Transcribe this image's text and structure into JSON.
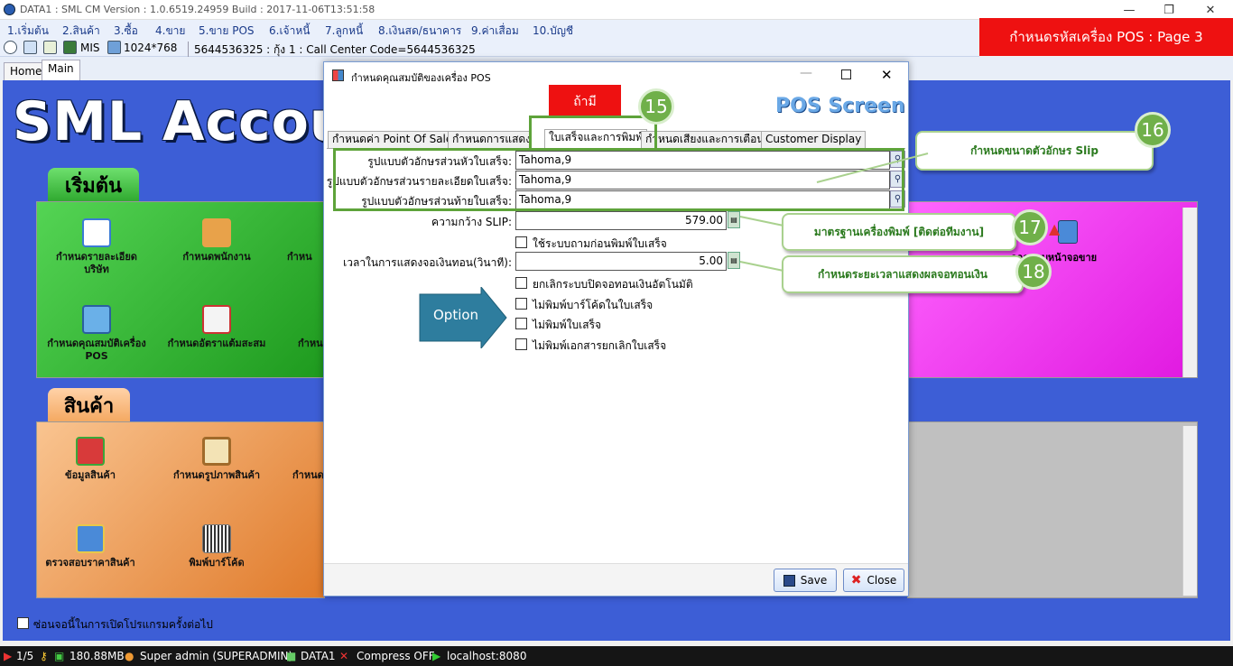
{
  "window": {
    "title": "DATA1 : SML CM Version : 1.0.6519.24959  Build : 2017-11-06T13:51:58",
    "minimize": "—",
    "maximize": "❐",
    "close": "✕"
  },
  "menu": [
    "1.เริ่มต้น",
    "2.สินค้า",
    "3.ซื้อ",
    "4.ขาย",
    "5.ขาย POS",
    "6.เจ้าหนี้",
    "7.ลูกหนี้",
    "8.เงินสด/ธนาคาร",
    "9.ค่าเสื่อม",
    "10.บัญชี"
  ],
  "page_header": "กำหนดรหัสเครื่อง POS : Page 3",
  "toolbar": {
    "mis": "MIS",
    "resolution": "1024*768",
    "info": "5644536325 : กุ้ง 1 : Call Center Code=5644536325"
  },
  "tabs": [
    "Home",
    "Main"
  ],
  "main": {
    "big_title": "SML Accou",
    "panel1": {
      "tab": "เริ่มต้น",
      "items": [
        "กำหนดรายละเอียดบริษัท",
        "กำหนดพนักงาน",
        "กำหน",
        "กำหนดคุณสมบัติเครื่อง POS",
        "กำหนดอัตราแต้มสะสม",
        "กำหน"
      ]
    },
    "panel2": {
      "tab": "สินค้า",
      "items": [
        "ข้อมูลสินค้า",
        "กำหนดรูปภาพสินค้า",
        "กำหนด",
        "ตรวจสอบราคาสินค้า",
        "พิมพ์บาร์โค้ด"
      ]
    },
    "right_item": "ออกแบบหน้าจอขาย",
    "hide_checkbox_label": "ซ่อนจอนี้ในการเปิดโปรแกรมครั้งต่อไป"
  },
  "status": {
    "page": "1/5",
    "memory": "180.88MB",
    "user": "Super admin (SUPERADMIN)",
    "db": "DATA1",
    "compress": "Compress OFF",
    "host": "localhost:8080"
  },
  "dialog": {
    "title": "กำหนดคุณสมบัติของเครื่อง POS",
    "header": "POS Screen",
    "red_label": "ถ้ามี",
    "tabs": [
      "กำหนดค่า Point Of Sale",
      "กำหนดการแสดงผล",
      "ใบเสร็จและการพิมพ์",
      "กำหนดเสียงและการเตือน",
      "Customer Display"
    ],
    "fields": [
      {
        "label": "รูปแบบตัวอักษรส่วนหัวใบเสร็จ:",
        "value": "Tahoma,9"
      },
      {
        "label": "รูปแบบตัวอักษรส่วนรายละเอียดใบเสร็จ:",
        "value": "Tahoma,9"
      },
      {
        "label": "รูปแบบตัวอักษรส่วนท้ายใบเสร็จ:",
        "value": "Tahoma,9"
      }
    ],
    "slip_width_label": "ความกว้าง SLIP:",
    "slip_width_value": "579.00",
    "ask_print_label": "ใช้ระบบถามก่อนพิมพ์ใบเสร็จ",
    "change_time_label": "เวลาในการแสดงจอเงินทอน(วินาที):",
    "change_time_value": "5.00",
    "options": [
      "ยกเลิกระบบปิดจอทอนเงินอัตโนมัติ",
      "ไม่พิมพ์บาร์โค้ดในใบเสร็จ",
      "ไม่พิมพ์ใบเสร็จ",
      "ไม่พิมพ์เอกสารยกเลิกใบเสร็จ"
    ],
    "save": "Save",
    "close": "Close"
  },
  "annotations": {
    "badges": [
      "15",
      "16",
      "17",
      "18"
    ],
    "callout16": "กำหนดขนาดตัวอักษร Slip",
    "callout17": "มาตรฐานเครื่องพิมพ์ [ติดต่อทีมงาน]",
    "callout18": "กำหนดระยะเวลาแสดงผลจอทอนเงิน",
    "option_arrow": "Option"
  }
}
